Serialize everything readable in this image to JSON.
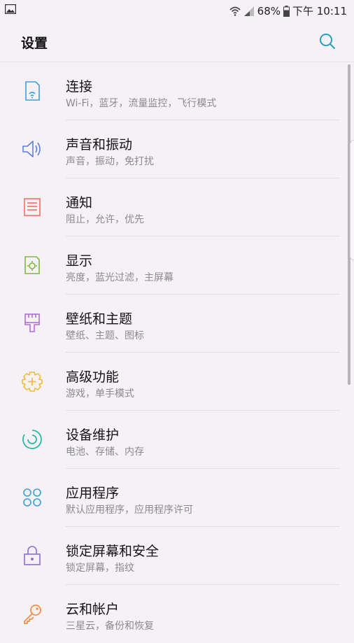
{
  "status_bar": {
    "battery": "68%",
    "time": "下午 10:11"
  },
  "header": {
    "title": "设置"
  },
  "settings": [
    {
      "label": "连接",
      "sub": "Wi-Fi，蓝牙，流量监控，飞行模式",
      "icon": "connection-icon",
      "color": "#3b9fd6"
    },
    {
      "label": "声音和振动",
      "sub": "声音，振动，免打扰",
      "icon": "speaker-icon",
      "color": "#5b7fe0"
    },
    {
      "label": "通知",
      "sub": "阻止，允许，优先",
      "icon": "notification-icon",
      "color": "#f07060"
    },
    {
      "label": "显示",
      "sub": "亮度，蓝光过滤，主屏幕",
      "icon": "display-icon",
      "color": "#7cba3c"
    },
    {
      "label": "壁纸和主题",
      "sub": "壁纸、主题、图标",
      "icon": "brush-icon",
      "color": "#b16fd6"
    },
    {
      "label": "高级功能",
      "sub": "游戏，单手模式",
      "icon": "gear-plus-icon",
      "color": "#f2b830"
    },
    {
      "label": "设备维护",
      "sub": "电池、存储、内存",
      "icon": "maintenance-icon",
      "color": "#2fb8a0"
    },
    {
      "label": "应用程序",
      "sub": "默认应用程序，应用程序许可",
      "icon": "apps-grid-icon",
      "color": "#3b9fd6"
    },
    {
      "label": "锁定屏幕和安全",
      "sub": "锁定屏幕，指纹",
      "icon": "lock-icon",
      "color": "#8a6fd6"
    },
    {
      "label": "云和帐户",
      "sub": "三星云，备份和恢复",
      "icon": "key-icon",
      "color": "#f08c40"
    }
  ]
}
